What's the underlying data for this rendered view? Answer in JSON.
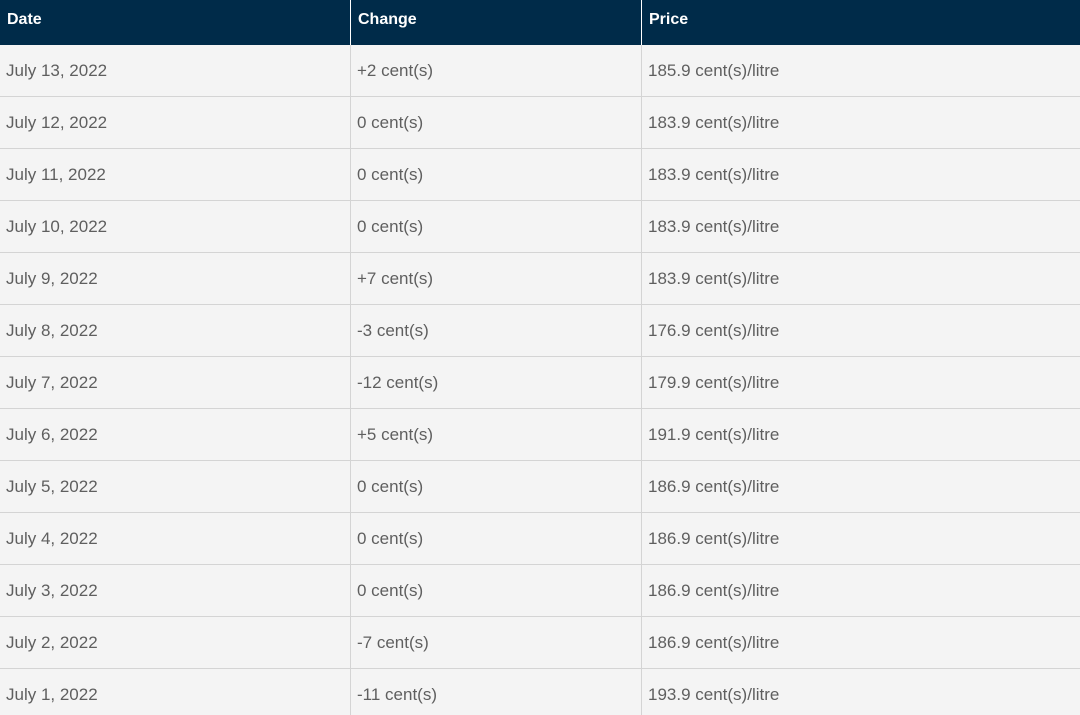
{
  "table": {
    "headers": [
      "Date",
      "Change",
      "Price"
    ],
    "rows": [
      [
        "July 13, 2022",
        "+2 cent(s)",
        "185.9 cent(s)/litre"
      ],
      [
        "July 12, 2022",
        "0 cent(s)",
        "183.9 cent(s)/litre"
      ],
      [
        "July 11, 2022",
        "0 cent(s)",
        "183.9 cent(s)/litre"
      ],
      [
        "July 10, 2022",
        "0 cent(s)",
        "183.9 cent(s)/litre"
      ],
      [
        "July 9, 2022",
        "+7 cent(s)",
        "183.9 cent(s)/litre"
      ],
      [
        "July 8, 2022",
        "-3 cent(s)",
        "176.9 cent(s)/litre"
      ],
      [
        "July 7, 2022",
        "-12 cent(s)",
        "179.9 cent(s)/litre"
      ],
      [
        "July 6, 2022",
        "+5 cent(s)",
        "191.9 cent(s)/litre"
      ],
      [
        "July 5, 2022",
        "0 cent(s)",
        "186.9 cent(s)/litre"
      ],
      [
        "July 4, 2022",
        "0 cent(s)",
        "186.9 cent(s)/litre"
      ],
      [
        "July 3, 2022",
        "0 cent(s)",
        "186.9 cent(s)/litre"
      ],
      [
        "July 2, 2022",
        "-7 cent(s)",
        "186.9 cent(s)/litre"
      ],
      [
        "July 1, 2022",
        "-11 cent(s)",
        "193.9 cent(s)/litre"
      ]
    ]
  },
  "colors": {
    "header_bg": "#002b49",
    "header_text": "#ffffff",
    "row_bg": "#f4f4f4",
    "cell_text": "#5f5f5f",
    "border": "#d4d4d4"
  }
}
